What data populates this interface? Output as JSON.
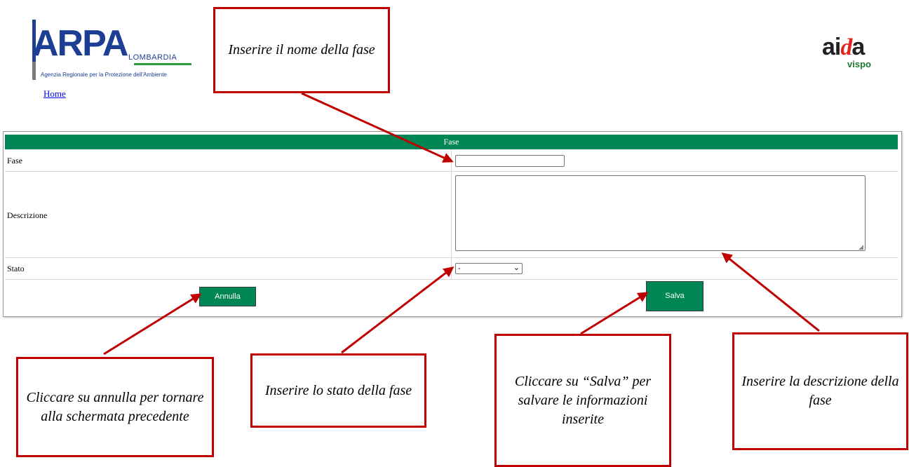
{
  "header": {
    "logo_arpa": {
      "word": "ARPA",
      "region": "LOMBARDIA",
      "subtitle": "Agenzia Regionale per la Protezione dell'Ambiente"
    },
    "home_link": "Home",
    "logo_aida": {
      "word_a": "ai",
      "word_d": "d",
      "word_b": "a",
      "sub": "vispo"
    }
  },
  "form": {
    "title": "Fase",
    "fields": [
      {
        "label": "Fase",
        "type": "text",
        "value": ""
      },
      {
        "label": "Descrizione",
        "type": "textarea",
        "value": ""
      },
      {
        "label": "Stato",
        "type": "select",
        "selected": "-"
      }
    ],
    "buttons": {
      "cancel": "Annulla",
      "save": "Salva"
    }
  },
  "callouts": {
    "nome": "Inserire il nome della fase",
    "annulla": "Cliccare su annulla per tornare alla schermata precedente",
    "stato": "Inserire lo stato della fase",
    "salva": "Cliccare su “Salva” per salvare le informazioni inserite",
    "descrizione": "Inserire la descrizione della fase"
  },
  "colors": {
    "header_green": "#008555",
    "callout_red": "#c00000",
    "arpa_blue": "#1c3f94"
  }
}
